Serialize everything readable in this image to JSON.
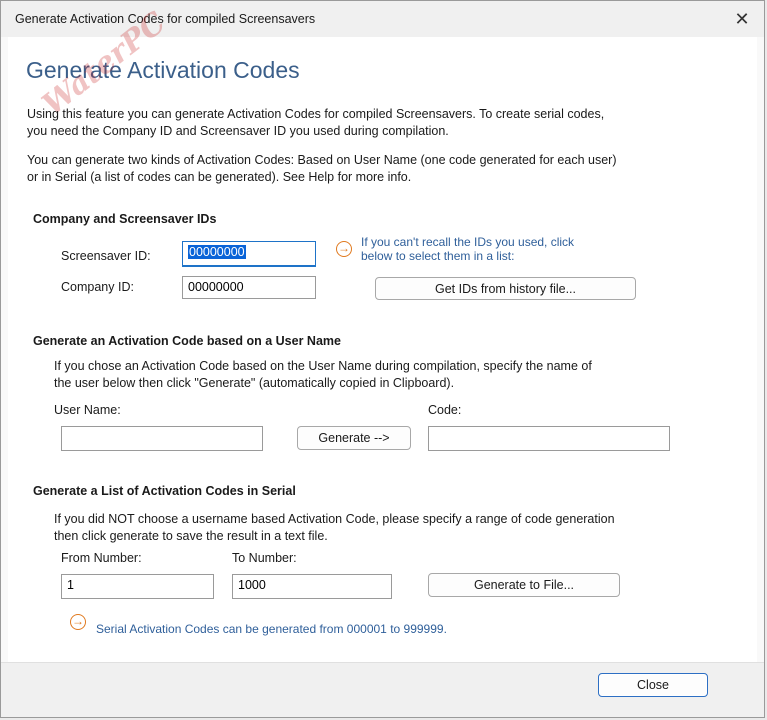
{
  "window": {
    "title": "Generate Activation Codes for compiled Screensavers",
    "close_glyph": "✕"
  },
  "header": {
    "heading": "Generate Activation Codes",
    "intro1_line1": "Using this feature you can generate Activation Codes for compiled Screensavers. To create serial codes,",
    "intro1_line2": "you need the Company ID and Screensaver ID you used during compilation.",
    "intro2_line1": "You can generate two kinds of Activation Codes: Based on User Name (one code generated for each user)",
    "intro2_line2": "or in Serial (a list of codes can be generated). See Help for more info.",
    "watermark": "WaterPC"
  },
  "ids": {
    "section_title": "Company and Screensaver IDs",
    "screensaver_label": "Screensaver ID:",
    "screensaver_value": "00000000",
    "company_label": "Company ID:",
    "company_value": "00000000",
    "hint_line1": "If you can't recall the IDs you used, click",
    "hint_line2": "below to select them in a list:",
    "history_button": "Get IDs from history file..."
  },
  "username": {
    "section_title": "Generate an Activation Code based on a User Name",
    "desc_line1": "If you chose an Activation Code based on the User Name during compilation, specify the name of",
    "desc_line2": "the user below then click \"Generate\" (automatically copied in Clipboard).",
    "user_label": "User Name:",
    "user_value": "",
    "code_label": "Code:",
    "code_value": "",
    "generate_button": "Generate -->"
  },
  "serial": {
    "section_title": "Generate a List of Activation Codes in Serial",
    "desc_line1": "If you did NOT choose a username based Activation Code, please specify a range of code generation",
    "desc_line2": "then click generate to save the result in a text file.",
    "from_label": "From Number:",
    "from_value": "1",
    "to_label": "To Number:",
    "to_value": "1000",
    "generate_file_button": "Generate to File...",
    "range_note": "Serial Activation Codes can be generated from 000001 to 999999."
  },
  "footer": {
    "close_button": "Close"
  },
  "icons": {
    "arrow_glyph": "→",
    "accent_color": "#e07a20"
  }
}
